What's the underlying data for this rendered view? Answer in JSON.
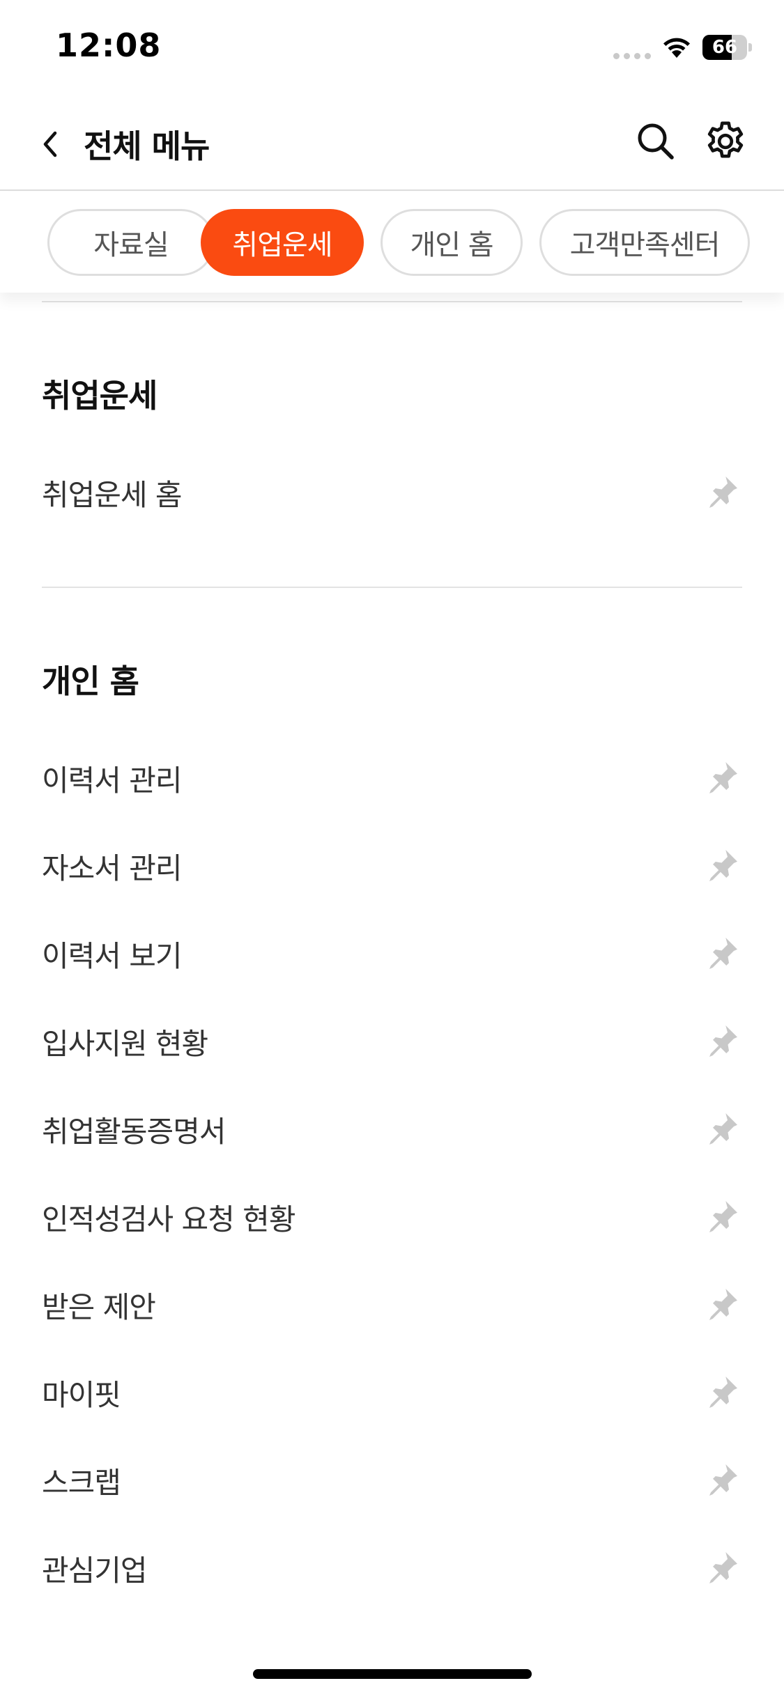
{
  "status_bar": {
    "time": "12:08",
    "battery_percent": "66",
    "battery_level": 0.66
  },
  "header": {
    "title": "전체 메뉴",
    "back_icon": "chevron-left-icon",
    "search_icon": "search-icon",
    "settings_icon": "gear-icon"
  },
  "chips": [
    {
      "label": "자료실",
      "active": false
    },
    {
      "label": "취업운세",
      "active": true
    },
    {
      "label": "개인 홈",
      "active": false
    },
    {
      "label": "고객만족센터",
      "active": false
    }
  ],
  "sections": [
    {
      "title": "취업운세",
      "items": [
        {
          "label": "취업운세 홈"
        }
      ]
    },
    {
      "title": "개인 홈",
      "items": [
        {
          "label": "이력서 관리"
        },
        {
          "label": "자소서 관리"
        },
        {
          "label": "이력서 보기"
        },
        {
          "label": "입사지원 현황"
        },
        {
          "label": "취업활동증명서"
        },
        {
          "label": "인적성검사 요청 현황"
        },
        {
          "label": "받은 제안"
        },
        {
          "label": "마이핏"
        },
        {
          "label": "스크랩"
        },
        {
          "label": "관심기업"
        }
      ]
    }
  ],
  "colors": {
    "accent": "#fa4b11",
    "pin": "#c8c8c8",
    "divider": "#e3e3e3"
  }
}
